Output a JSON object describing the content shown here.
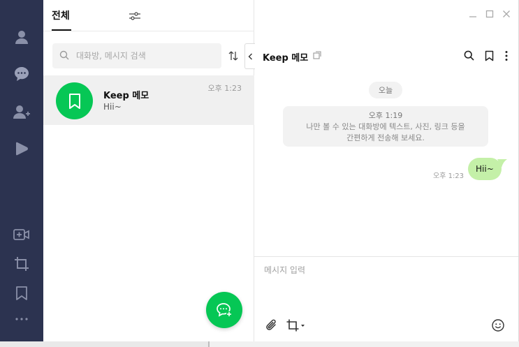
{
  "sidebar": {
    "items": [
      {
        "icon": "person-icon",
        "label": "friends"
      },
      {
        "icon": "chat-bubble-icon",
        "label": "chats"
      },
      {
        "icon": "add-friend-icon",
        "label": "add friend"
      },
      {
        "icon": "play-icon",
        "label": "line voom"
      }
    ],
    "bottom_items": [
      "video-call-icon",
      "screen-capture-icon",
      "bookmark-icon",
      "more-icon"
    ]
  },
  "list": {
    "tab_label": "전체",
    "search_placeholder": "대화방, 메시지 검색",
    "chats": [
      {
        "name": "Keep 메모",
        "preview": "Hii~",
        "time": "오후 1:23"
      }
    ]
  },
  "chat": {
    "title": "Keep 메모",
    "date_label": "오늘",
    "system_time": "오후 1:19",
    "system_line1": "나만 볼 수 있는 대화방에 텍스트, 사진, 링크 등을",
    "system_line2": "간편하게 전송해 보세요.",
    "messages": [
      {
        "text": "Hii~",
        "time": "오후 1:23",
        "mine": true
      }
    ],
    "input_placeholder": "메시지 입력"
  },
  "colors": {
    "sidebar": "#2c3350",
    "accent": "#06c755",
    "bubble": "#c4f0a8"
  }
}
